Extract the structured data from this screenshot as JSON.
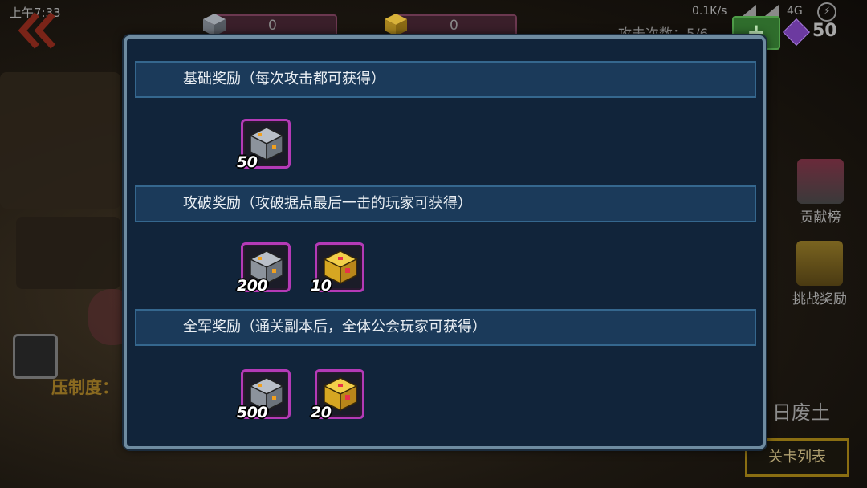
{
  "status_bar": {
    "time": "上午7:33",
    "speed": "0.1K/s",
    "network": "4G",
    "battery": "⚡"
  },
  "background": {
    "top_left_res_value": "0",
    "top_mid_res_value": "0",
    "attack_count": "攻击次数：5/6",
    "plus_label": "+",
    "gems": "50",
    "contribution_label": "贡献榜",
    "challenge_reward_label": "挑战奖励",
    "suppress_label": "压制度：",
    "stage_name": "日废土",
    "level_list_label": "关卡列表"
  },
  "modal": {
    "sections": [
      {
        "title": "基础奖励（每次攻击都可获得）",
        "rewards": [
          {
            "icon": "silver-cube-icon",
            "qty": "50"
          }
        ]
      },
      {
        "title": "攻破奖励（攻破据点最后一击的玩家可获得）",
        "rewards": [
          {
            "icon": "silver-cube-icon",
            "qty": "200"
          },
          {
            "icon": "gold-cube-icon",
            "qty": "10"
          }
        ]
      },
      {
        "title": "全军奖励（通关副本后，全体公会玩家可获得）",
        "rewards": [
          {
            "icon": "silver-cube-icon",
            "qty": "500"
          },
          {
            "icon": "gold-cube-icon",
            "qty": "20"
          }
        ]
      }
    ]
  },
  "colors": {
    "modal_bg": "#11243a",
    "header_bg": "#1b3a5a",
    "reward_border": "#b43ab6"
  }
}
